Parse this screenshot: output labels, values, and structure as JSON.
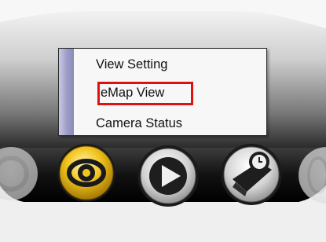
{
  "context_menu": {
    "items": [
      {
        "label": "View Setting"
      },
      {
        "label": "eMap View",
        "highlighted": true
      },
      {
        "label": "Camera Status"
      }
    ]
  },
  "toolbar": {
    "buttons": [
      {
        "icon": "eye-icon",
        "state": "active"
      },
      {
        "icon": "play-icon",
        "state": "normal"
      },
      {
        "icon": "clock-playback-icon",
        "state": "normal"
      }
    ]
  },
  "colors": {
    "highlight_border": "#e01010",
    "menu_strip": "#9c9cc7",
    "active_button": "#f0c020"
  }
}
